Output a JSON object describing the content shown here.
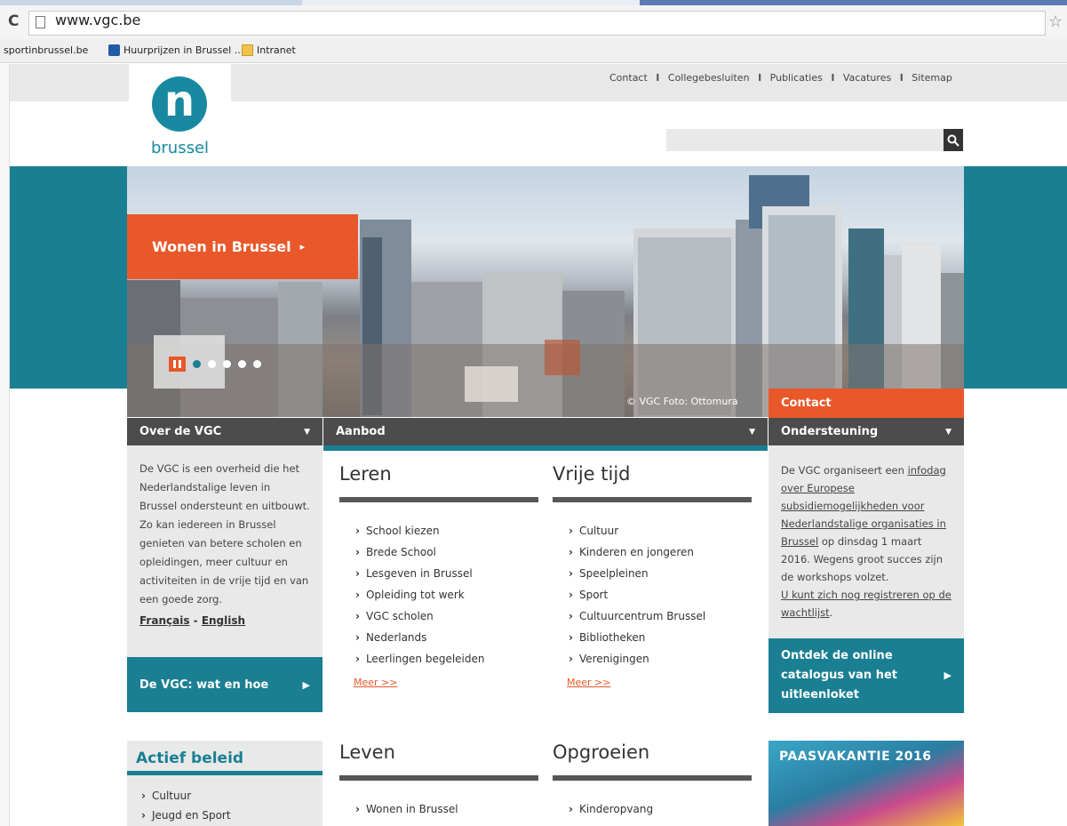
{
  "browser": {
    "url": "www.vgc.be",
    "bookmarks": [
      {
        "label": "sportinbrussel.be"
      },
      {
        "label": "Huurprijzen in Brussel ..."
      },
      {
        "label": "Intranet"
      }
    ]
  },
  "site": {
    "logo_text": "brussel",
    "logo_letter": "n",
    "top_links": [
      "Contact",
      "Collegebesluiten",
      "Publicaties",
      "Vacatures",
      "Sitemap"
    ],
    "top_link_separator": "I",
    "search_placeholder": ""
  },
  "hero": {
    "button_label": "Wonen in Brussel",
    "button_arrow": "▸",
    "caption": "© VGC Foto: Ottomura"
  },
  "left": {
    "header": "Over de VGC",
    "text": "De VGC is een overheid die het Nederlandstalige leven in Brussel ondersteunt en uitbouwt. Zo kan iedereen in Brussel genieten van betere scholen en opleidingen, meer cultuur en activiteiten in de vrije tijd en van een goede zorg.",
    "lang_fr": "Français",
    "lang_sep": " - ",
    "lang_en": "English",
    "cta": "De VGC: wat en hoe"
  },
  "middle": {
    "header": "Aanbod",
    "leren": {
      "title": "Leren",
      "items": [
        "School kiezen",
        "Brede School",
        "Lesgeven in Brussel",
        "Opleiding tot werk",
        "VGC scholen",
        "Nederlands",
        "Leerlingen begeleiden"
      ],
      "more": "Meer >>"
    },
    "vrije_tijd": {
      "title": "Vrije tijd",
      "items": [
        "Cultuur",
        "Kinderen en jongeren",
        "Speelpleinen",
        "Sport",
        "Cultuurcentrum Brussel",
        "Bibliotheken",
        "Verenigingen"
      ],
      "more": "Meer >>"
    },
    "leven": {
      "title": "Leven",
      "items": [
        "Wonen in Brussel"
      ]
    },
    "opgroeien": {
      "title": "Opgroeien",
      "items": [
        "Kinderopvang"
      ]
    }
  },
  "right": {
    "tab": "Contact",
    "header": "Ondersteuning",
    "text_a": "De VGC organiseert een ",
    "link_a": "infodag over Europese subsidiemogelijkheden voor Nederlandstalige organisaties in Brussel",
    "text_b": " op dinsdag 1 maart 2016. Wegens groot succes zijn de workshops volzet.",
    "link_b": "U kunt zich nog registreren op de wachtlijst",
    "text_c": ".",
    "cta": "Ontdek de online catalogus van het uitleenloket"
  },
  "beleid": {
    "title": "Actief beleid",
    "items": [
      "Cultuur",
      "Jeugd en Sport"
    ]
  },
  "promo": {
    "title": "PAASVAKANTIE 2016"
  }
}
